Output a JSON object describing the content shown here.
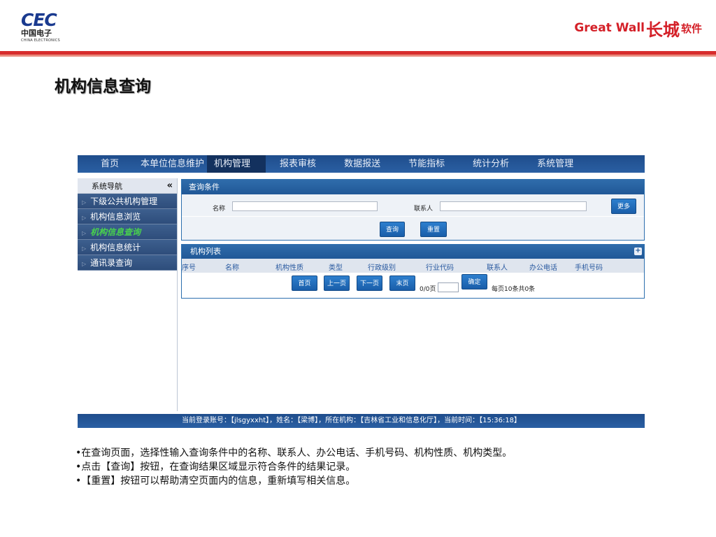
{
  "logos": {
    "cec": "CEC",
    "cec_cn": "中国电子",
    "cec_en": "CHINA ELECTRONICS",
    "gw": "Great Wall",
    "gw_cn": "软件"
  },
  "page_title": "机构信息查询",
  "topnav": [
    "首页",
    "本单位信息维护",
    "机构管理",
    "报表审核",
    "数据报送",
    "节能指标",
    "统计分析",
    "系统管理"
  ],
  "sidebar": {
    "header": "系统导航",
    "collapse": "«",
    "items": [
      {
        "label": "下级公共机构管理"
      },
      {
        "label": "机构信息浏览"
      },
      {
        "label": "机构信息查询"
      },
      {
        "label": "机构信息统计"
      },
      {
        "label": "通讯录查询"
      }
    ]
  },
  "query": {
    "title": "查询条件",
    "name_label": "名称",
    "contact_label": "联系人",
    "more_button": "更多",
    "search_button": "查询",
    "reset_button": "重置"
  },
  "list": {
    "title": "机构列表",
    "add": "+",
    "columns": [
      "序号",
      "名称",
      "机构性质",
      "类型",
      "行政级别",
      "行业代码",
      "联系人",
      "办公电话",
      "手机号码"
    ],
    "pager": {
      "first": "首页",
      "prev": "上一页",
      "next": "下一页",
      "last": "末页",
      "page_info": "0/0页",
      "confirm": "确定",
      "summary": "每页10条共0条"
    }
  },
  "status_bar": "当前登录账号：【jlsgyxxht】，姓名：【梁博】，所在机构：【吉林省工业和信息化厅】，当前时间：【15:36:18】",
  "notes": [
    "•在查询页面，选择性输入查询条件中的名称、联系人、办公电话、手机号码、机构性质、机构类型。",
    "•点击【查询】按钮，在查询结果区域显示符合条件的结果记录。",
    "•【重置】按钮可以帮助清空页面内的信息，重新填写相关信息。"
  ]
}
